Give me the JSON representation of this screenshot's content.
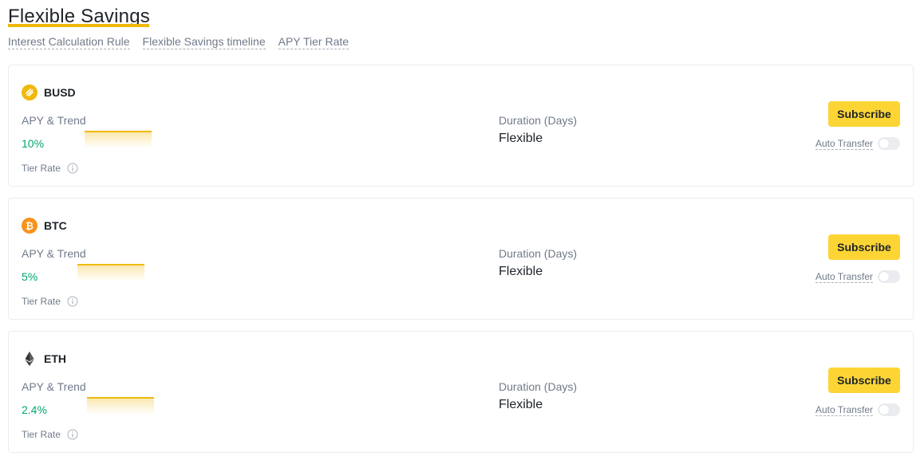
{
  "page": {
    "title": "Flexible Savings",
    "tabs": [
      {
        "label": "Interest Calculation Rule"
      },
      {
        "label": "Flexible Savings timeline"
      },
      {
        "label": "APY Tier Rate"
      }
    ]
  },
  "labels": {
    "apy_trend": "APY & Trend",
    "tier_rate": "Tier Rate",
    "duration": "Duration (Days)",
    "subscribe": "Subscribe",
    "auto_transfer": "Auto Transfer"
  },
  "products": [
    {
      "coin": "BUSD",
      "icon": "busd-coin-icon",
      "apy": "10%",
      "duration": "Flexible",
      "auto_transfer_on": false
    },
    {
      "coin": "BTC",
      "icon": "btc-coin-icon",
      "apy": "5%",
      "duration": "Flexible",
      "auto_transfer_on": false
    },
    {
      "coin": "ETH",
      "icon": "eth-coin-icon",
      "apy": "2.4%",
      "duration": "Flexible",
      "auto_transfer_on": false
    }
  ],
  "colors": {
    "accent": "#f0b90b",
    "button": "#fcd535",
    "apy_green": "#03a66d",
    "muted_text": "#707a8a"
  }
}
